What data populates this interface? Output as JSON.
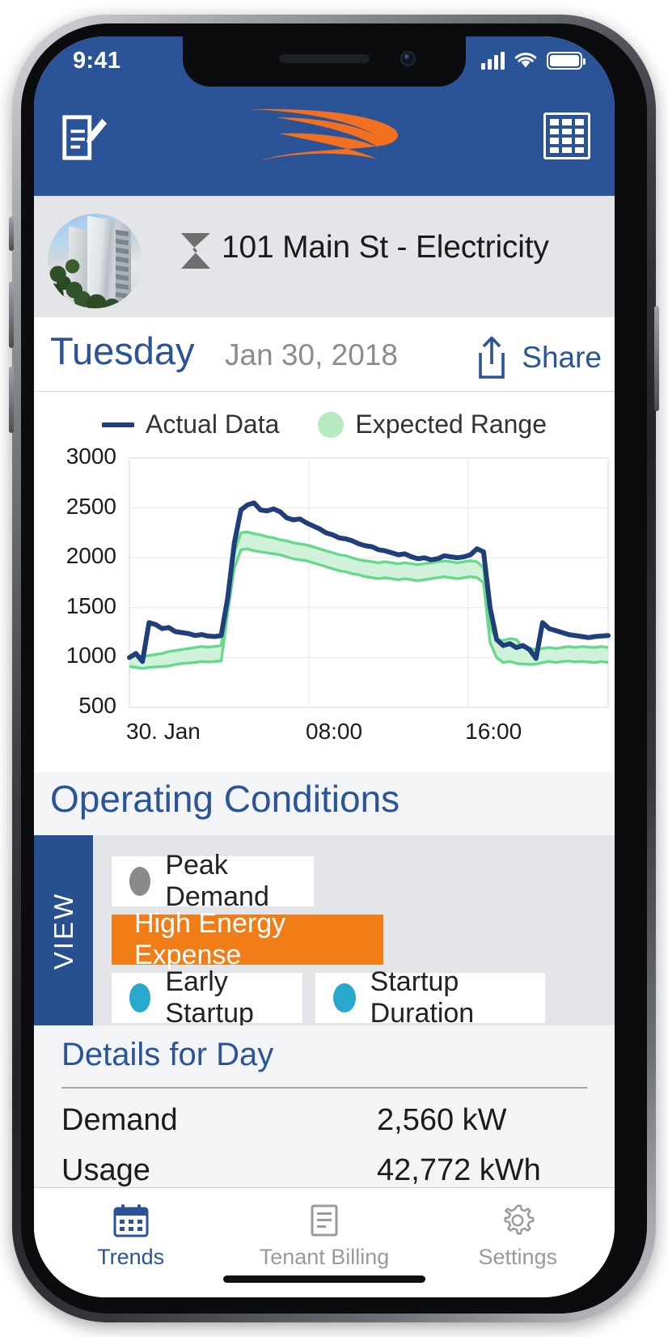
{
  "status_bar": {
    "time": "9:41",
    "signal_icon": "cellular-signal-icon",
    "wifi_icon": "wifi-icon",
    "battery_icon": "battery-full-icon"
  },
  "app_bar": {
    "left_icon": "notes-edit-icon",
    "logo": "swoosh-logo",
    "right_icon": "grid-calendar-icon",
    "brand_color": "#2b5398",
    "accent_color": "#f07d18"
  },
  "building_header": {
    "avatar": "building-photo-avatar",
    "meter_icon": "electricity-bolt-icon",
    "title": "101 Main St - Electricity"
  },
  "date_bar": {
    "day": "Tuesday",
    "date": "Jan 30, 2018",
    "share_icon": "share-upload-icon",
    "share_label": "Share"
  },
  "chart_data": {
    "type": "line",
    "title": "",
    "xlabel": "",
    "ylabel": "",
    "ylim": [
      500,
      3000
    ],
    "yticks": [
      500,
      1000,
      1500,
      2000,
      2500,
      3000
    ],
    "xticks": [
      "30. Jan",
      "08:00",
      "16:00"
    ],
    "xtick_positions": [
      0,
      0.375,
      0.708
    ],
    "grid": true,
    "legend": [
      {
        "name": "Actual Data",
        "marker": "line",
        "color": "#1f3f7a"
      },
      {
        "name": "Expected Range",
        "marker": "circle",
        "color": "#b6ebc2"
      }
    ],
    "series": [
      {
        "name": "Actual Data",
        "color": "#1f3f7a",
        "values": [
          1000,
          1040,
          960,
          1350,
          1330,
          1290,
          1300,
          1260,
          1250,
          1240,
          1220,
          1230,
          1215,
          1210,
          1220,
          1600,
          2150,
          2480,
          2530,
          2550,
          2480,
          2470,
          2490,
          2460,
          2400,
          2380,
          2390,
          2350,
          2320,
          2290,
          2250,
          2230,
          2200,
          2190,
          2170,
          2140,
          2120,
          2110,
          2080,
          2070,
          2050,
          2030,
          2040,
          2010,
          1990,
          2000,
          1980,
          1990,
          2020,
          2010,
          2000,
          2010,
          2030,
          2090,
          2060,
          1500,
          1180,
          1120,
          1140,
          1100,
          1120,
          1080,
          990,
          1350,
          1290,
          1270,
          1250,
          1230,
          1220,
          1210,
          1200,
          1210,
          1215,
          1220
        ]
      },
      {
        "name": "Expected Range Upper",
        "color": "#67d98a",
        "values": [
          1010,
          1020,
          1010,
          1020,
          1030,
          1040,
          1060,
          1070,
          1080,
          1090,
          1100,
          1110,
          1105,
          1110,
          1120,
          1600,
          2050,
          2250,
          2260,
          2240,
          2230,
          2210,
          2200,
          2180,
          2170,
          2150,
          2140,
          2130,
          2110,
          2090,
          2070,
          2050,
          2030,
          2020,
          2000,
          1980,
          1970,
          1960,
          1950,
          1960,
          1950,
          1940,
          1950,
          1940,
          1930,
          1940,
          1950,
          1960,
          1970,
          1960,
          1950,
          1960,
          1970,
          1960,
          1900,
          1300,
          1180,
          1170,
          1190,
          1180,
          1100,
          1090,
          1080,
          1090,
          1100,
          1090,
          1100,
          1110,
          1100,
          1110,
          1105,
          1100,
          1110,
          1100
        ]
      },
      {
        "name": "Expected Range Lower",
        "color": "#67d98a",
        "values": [
          910,
          900,
          890,
          900,
          905,
          910,
          915,
          930,
          940,
          945,
          950,
          960,
          955,
          960,
          965,
          1450,
          1900,
          2080,
          2090,
          2070,
          2060,
          2050,
          2040,
          2030,
          2010,
          1990,
          1980,
          1970,
          1950,
          1930,
          1910,
          1890,
          1870,
          1860,
          1840,
          1830,
          1810,
          1800,
          1790,
          1800,
          1790,
          1780,
          1790,
          1780,
          1770,
          1780,
          1790,
          1800,
          1810,
          1800,
          1790,
          1800,
          1810,
          1800,
          1750,
          1150,
          1000,
          950,
          960,
          940,
          935,
          930,
          935,
          950,
          960,
          950,
          960,
          965,
          955,
          960,
          955,
          950,
          960,
          950
        ]
      }
    ]
  },
  "operating_conditions": {
    "title": "Operating Conditions",
    "rail_label": "VIEW",
    "chips": [
      {
        "label": "Peak Demand",
        "dot_color": "#8a8a8a",
        "active": false,
        "row": 0
      },
      {
        "label": "High Energy Expense",
        "dot_color": "",
        "active": true,
        "row": 1
      },
      {
        "label": "Early Startup",
        "dot_color": "#29a8cd",
        "active": false,
        "row": 2
      },
      {
        "label": "Startup Duration",
        "dot_color": "#29a8cd",
        "active": false,
        "row": 2
      }
    ]
  },
  "details": {
    "title": "Details for Day",
    "rows": [
      {
        "label": "Demand",
        "value": "2,560 kW"
      },
      {
        "label": "Usage",
        "value": "42,772 kWh"
      }
    ]
  },
  "tab_bar": {
    "tabs": [
      {
        "label": "Trends",
        "icon": "calendar-icon",
        "active": true
      },
      {
        "label": "Tenant Billing",
        "icon": "invoice-icon",
        "active": false
      },
      {
        "label": "Settings",
        "icon": "gear-icon",
        "active": false
      }
    ]
  }
}
